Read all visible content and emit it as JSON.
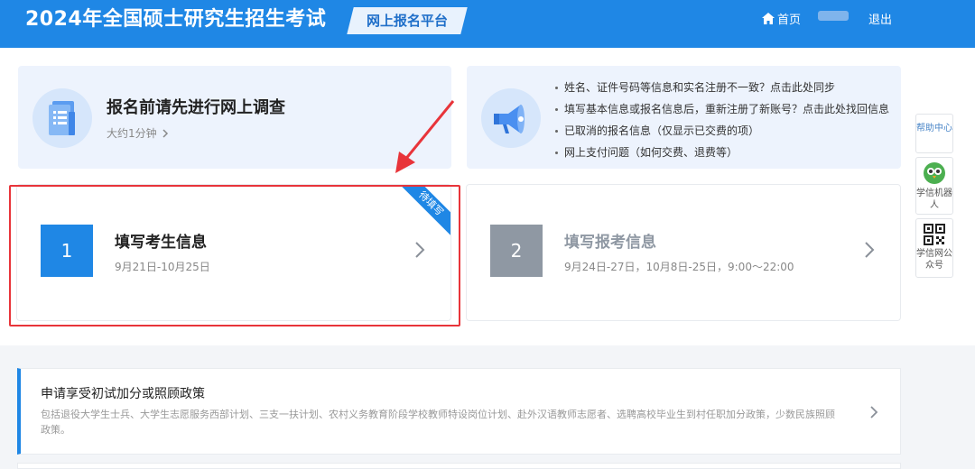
{
  "header": {
    "title": "2024年全国硕士研究生招生考试",
    "platform_badge": "网上报名平台",
    "home_label": "首页",
    "logout_label": "退出"
  },
  "survey": {
    "title": "报名前请先进行网上调查",
    "subtitle": "大约1分钟"
  },
  "notice": {
    "items": [
      "姓名、证件号码等信息和实名注册不一致？点击此处同步",
      "填写基本信息或报名信息后，重新注册了新账号？点击此处找回信息",
      "已取消的报名信息（仅显示已交费的项）",
      "网上支付问题（如何交费、退费等）"
    ]
  },
  "steps": [
    {
      "number": "1",
      "title": "填写考生信息",
      "date": "9月21日-10月25日",
      "ribbon": "待填写"
    },
    {
      "number": "2",
      "title": "填写报考信息",
      "date": "9月24日-27日，10月8日-25日，9:00～22:00"
    }
  ],
  "sidebar": {
    "help_label": "帮助中心",
    "robot_label": "学信机器人",
    "qr_label": "学信网公众号"
  },
  "policy": {
    "title": "申请享受初试加分或照顾政策",
    "description": "包括退役大学生士兵、大学生志愿服务西部计划、三支一扶计划、农村义务教育阶段学校教师特设岗位计划、赴外汉语教师志愿者、选聘高校毕业生到村任职加分政策，少数民族照顾政策。"
  },
  "colors": {
    "brand_blue": "#1f87e5",
    "highlight_red": "#e8343a",
    "disabled_gray": "#8f98a3"
  }
}
